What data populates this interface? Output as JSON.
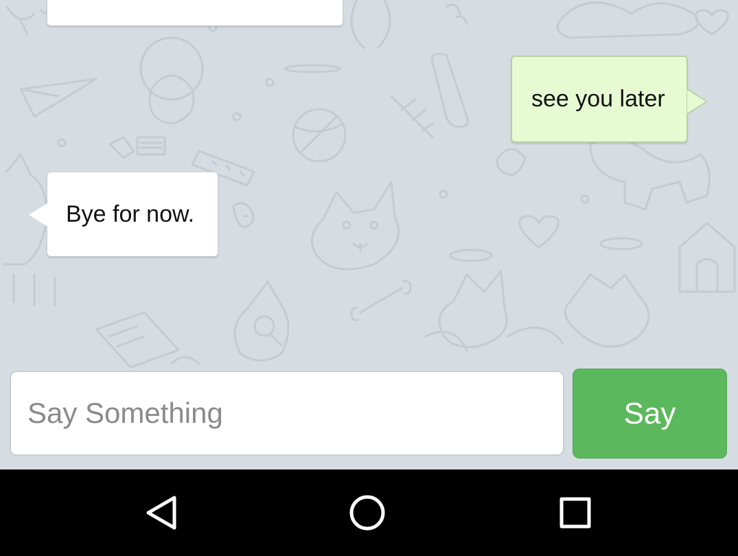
{
  "messages": [
    {
      "direction": "incoming",
      "text": ""
    },
    {
      "direction": "outgoing",
      "text": "see you later"
    },
    {
      "direction": "incoming",
      "text": "Bye for now."
    }
  ],
  "composer": {
    "placeholder": "Say Something",
    "value": "",
    "send_label": "Say"
  },
  "navigation": {
    "buttons": [
      {
        "icon": "back-icon"
      },
      {
        "icon": "home-icon"
      },
      {
        "icon": "recents-icon"
      }
    ]
  },
  "colors": {
    "chat_background": "#d5dde3",
    "outgoing_bubble": "#e7fbd2",
    "incoming_bubble": "#ffffff",
    "send_button": "#5cb85c",
    "nav_bar": "#000000"
  }
}
